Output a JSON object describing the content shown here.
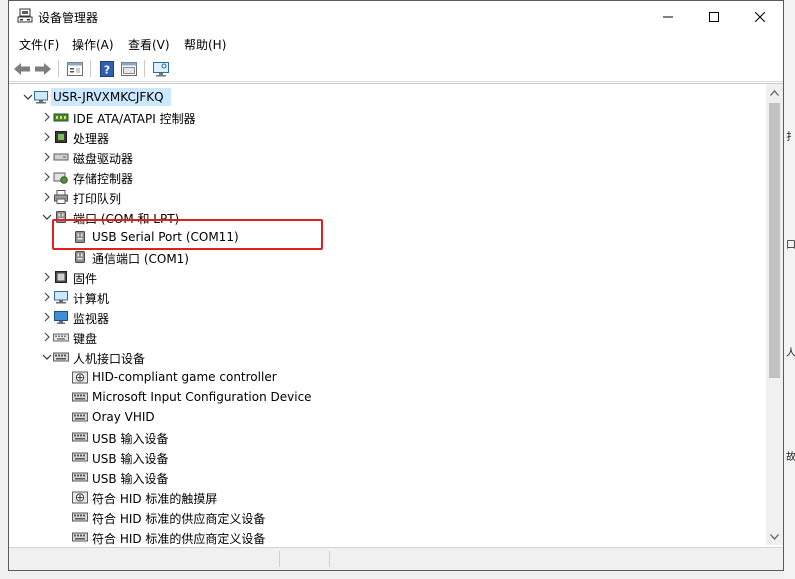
{
  "window": {
    "title": "设备管理器",
    "controls": {
      "minimize": "minimize",
      "maximize": "maximize",
      "close": "close"
    }
  },
  "menu": {
    "items": [
      {
        "label": "文件(F)"
      },
      {
        "label": "操作(A)"
      },
      {
        "label": "查看(V)"
      },
      {
        "label": "帮助(H)"
      }
    ]
  },
  "toolbar": {
    "buttons": [
      {
        "icon": "back-arrow-icon"
      },
      {
        "icon": "forward-arrow-icon"
      },
      {
        "icon": "properties-icon"
      },
      {
        "icon": "help-icon"
      },
      {
        "icon": "details-icon"
      },
      {
        "icon": "monitor-scan-icon"
      }
    ]
  },
  "tree": {
    "root": {
      "label": "USR-JRVXMKCJFKQ",
      "icon": "computer-icon",
      "expanded": true
    },
    "nodes": [
      {
        "label": "IDE ATA/ATAPI 控制器",
        "icon": "ide-controller-icon",
        "level": 1,
        "expander": "collapsed"
      },
      {
        "label": "处理器",
        "icon": "processor-icon",
        "level": 1,
        "expander": "collapsed"
      },
      {
        "label": "磁盘驱动器",
        "icon": "disk-drive-icon",
        "level": 1,
        "expander": "collapsed"
      },
      {
        "label": "存储控制器",
        "icon": "storage-controller-icon",
        "level": 1,
        "expander": "collapsed"
      },
      {
        "label": "打印队列",
        "icon": "printer-icon",
        "level": 1,
        "expander": "collapsed"
      },
      {
        "label": "端口 (COM 和 LPT)",
        "icon": "port-icon",
        "level": 1,
        "expander": "expanded"
      },
      {
        "label": "USB Serial Port (COM11)",
        "icon": "port-icon",
        "level": 2,
        "expander": "none"
      },
      {
        "label": "通信端口 (COM1)",
        "icon": "port-icon",
        "level": 2,
        "expander": "none"
      },
      {
        "label": "固件",
        "icon": "firmware-icon",
        "level": 1,
        "expander": "collapsed"
      },
      {
        "label": "计算机",
        "icon": "computer-icon",
        "level": 1,
        "expander": "collapsed"
      },
      {
        "label": "监视器",
        "icon": "monitor-icon",
        "level": 1,
        "expander": "collapsed"
      },
      {
        "label": "键盘",
        "icon": "keyboard-icon",
        "level": 1,
        "expander": "collapsed"
      },
      {
        "label": "人机接口设备",
        "icon": "hid-icon",
        "level": 1,
        "expander": "expanded"
      },
      {
        "label": "HID-compliant game controller",
        "icon": "hid-game-icon",
        "level": 2,
        "expander": "none"
      },
      {
        "label": "Microsoft Input Configuration Device",
        "icon": "hid-icon",
        "level": 2,
        "expander": "none"
      },
      {
        "label": "Oray VHID",
        "icon": "hid-icon",
        "level": 2,
        "expander": "none"
      },
      {
        "label": "USB 输入设备",
        "icon": "hid-icon",
        "level": 2,
        "expander": "none"
      },
      {
        "label": "USB 输入设备",
        "icon": "hid-icon",
        "level": 2,
        "expander": "none"
      },
      {
        "label": "USB 输入设备",
        "icon": "hid-icon",
        "level": 2,
        "expander": "none"
      },
      {
        "label": "符合 HID 标准的触摸屏",
        "icon": "hid-game-icon",
        "level": 2,
        "expander": "none"
      },
      {
        "label": "符合 HID 标准的供应商定义设备",
        "icon": "hid-icon",
        "level": 2,
        "expander": "none"
      },
      {
        "label": "符合 HID 标准的供应商定义设备",
        "icon": "hid-icon",
        "level": 2,
        "expander": "none"
      }
    ]
  },
  "colors": {
    "selection": "#cce8ff",
    "highlight_box": "#e02020",
    "scroll_thumb": "#c2c2c2"
  },
  "backdrop": {
    "right_chars": [
      "扌",
      "口",
      "人",
      "故"
    ]
  }
}
